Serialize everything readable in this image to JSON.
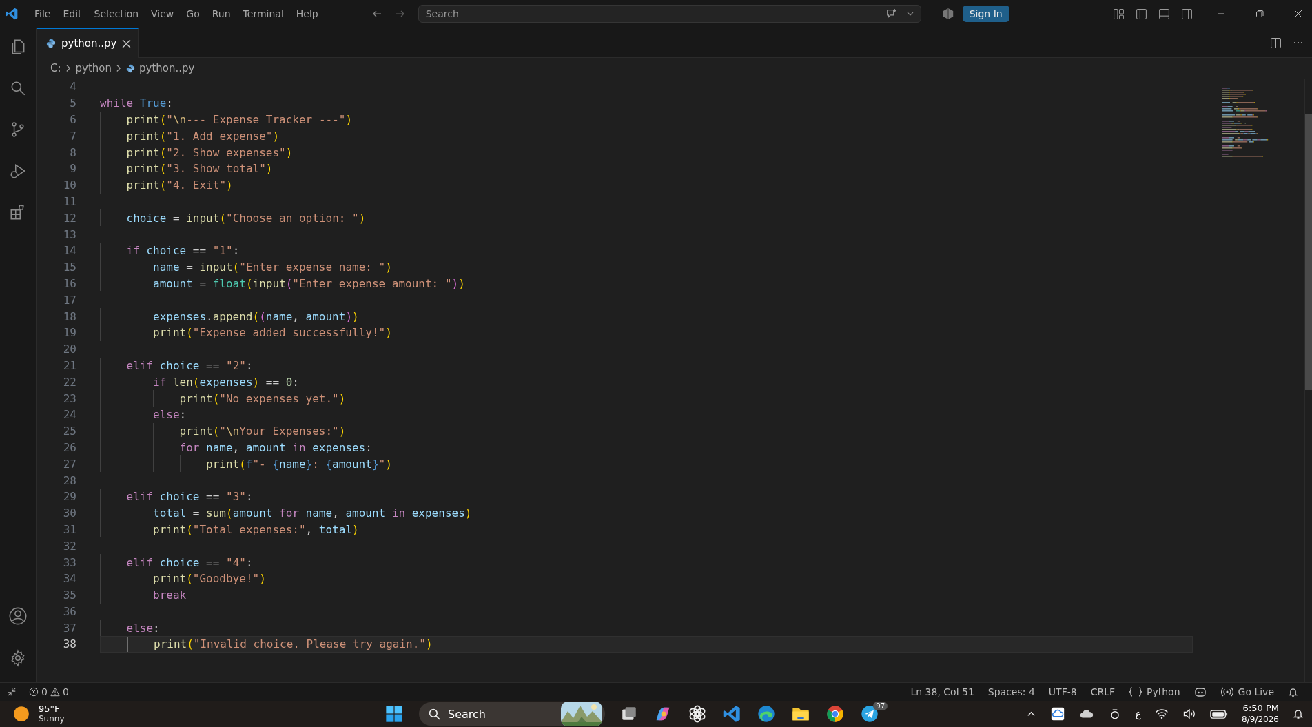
{
  "menu_bar": {
    "items": [
      "File",
      "Edit",
      "Selection",
      "View",
      "Go",
      "Run",
      "Terminal",
      "Help"
    ]
  },
  "command_center": {
    "placeholder": "Search"
  },
  "account_button": "Sign In",
  "tabs": [
    {
      "label": "python..py",
      "selected": true
    }
  ],
  "breadcrumb": [
    "C:",
    "python",
    "python..py"
  ],
  "editor": {
    "lines": [
      {
        "number": "4",
        "selected": false
      },
      {
        "number": "5",
        "selected": false,
        "tokens": [
          {
            "kind": "kw",
            "text": "while "
          },
          {
            "kind": "const",
            "text": "True"
          },
          {
            "kind": "op",
            "text": ":"
          }
        ]
      },
      {
        "number": "6",
        "selected": false,
        "tokens": [
          {
            "kind": "fn",
            "text": "    print"
          },
          {
            "kind": "b1",
            "text": "("
          },
          {
            "kind": "str",
            "text": "\""
          },
          {
            "kind": "esc",
            "text": "\\n"
          },
          {
            "kind": "str",
            "text": "--- Expense Tracker ---\""
          },
          {
            "kind": "b1",
            "text": ")"
          }
        ]
      },
      {
        "number": "7",
        "selected": false,
        "tokens": [
          {
            "kind": "fn",
            "text": "    print"
          },
          {
            "kind": "b1",
            "text": "("
          },
          {
            "kind": "str",
            "text": "\"1. Add expense\""
          },
          {
            "kind": "b1",
            "text": ")"
          }
        ]
      },
      {
        "number": "8",
        "selected": false,
        "tokens": [
          {
            "kind": "fn",
            "text": "    print"
          },
          {
            "kind": "b1",
            "text": "("
          },
          {
            "kind": "str",
            "text": "\"2. Show expenses\""
          },
          {
            "kind": "b1",
            "text": ")"
          }
        ]
      },
      {
        "number": "9",
        "selected": false,
        "tokens": [
          {
            "kind": "fn",
            "text": "    print"
          },
          {
            "kind": "b1",
            "text": "("
          },
          {
            "kind": "str",
            "text": "\"3. Show total\""
          },
          {
            "kind": "b1",
            "text": ")"
          }
        ]
      },
      {
        "number": "10",
        "selected": false,
        "tokens": [
          {
            "kind": "fn",
            "text": "    print"
          },
          {
            "kind": "b1",
            "text": "("
          },
          {
            "kind": "str",
            "text": "\"4. Exit\""
          },
          {
            "kind": "b1",
            "text": ")"
          }
        ]
      },
      {
        "number": "11",
        "selected": false
      },
      {
        "number": "12",
        "selected": false,
        "tokens": [
          {
            "kind": "var",
            "text": "    choice"
          },
          {
            "kind": "op",
            "text": " = "
          },
          {
            "kind": "fn",
            "text": "input"
          },
          {
            "kind": "b1",
            "text": "("
          },
          {
            "kind": "str",
            "text": "\"Choose an option: \""
          },
          {
            "kind": "b1",
            "text": ")"
          }
        ]
      },
      {
        "number": "13",
        "selected": false
      },
      {
        "number": "14",
        "selected": false,
        "tokens": [
          {
            "kind": "kw",
            "text": "    if "
          },
          {
            "kind": "var",
            "text": "choice"
          },
          {
            "kind": "op",
            "text": " == "
          },
          {
            "kind": "str",
            "text": "\"1\""
          },
          {
            "kind": "op",
            "text": ":"
          }
        ]
      },
      {
        "number": "15",
        "selected": false,
        "tokens": [
          {
            "kind": "var",
            "text": "        name"
          },
          {
            "kind": "op",
            "text": " = "
          },
          {
            "kind": "fn",
            "text": "input"
          },
          {
            "kind": "b1",
            "text": "("
          },
          {
            "kind": "str",
            "text": "\"Enter expense name: \""
          },
          {
            "kind": "b1",
            "text": ")"
          }
        ]
      },
      {
        "number": "16",
        "selected": false,
        "tokens": [
          {
            "kind": "var",
            "text": "        amount"
          },
          {
            "kind": "op",
            "text": " = "
          },
          {
            "kind": "type",
            "text": "float"
          },
          {
            "kind": "b1",
            "text": "("
          },
          {
            "kind": "fn",
            "text": "input"
          },
          {
            "kind": "b2",
            "text": "("
          },
          {
            "kind": "str",
            "text": "\"Enter expense amount: \""
          },
          {
            "kind": "b2",
            "text": ")"
          },
          {
            "kind": "b1",
            "text": ")"
          }
        ]
      },
      {
        "number": "17",
        "selected": false
      },
      {
        "number": "18",
        "selected": false,
        "tokens": [
          {
            "kind": "var",
            "text": "        expenses"
          },
          {
            "kind": "op",
            "text": "."
          },
          {
            "kind": "fn",
            "text": "append"
          },
          {
            "kind": "b1",
            "text": "("
          },
          {
            "kind": "b2",
            "text": "("
          },
          {
            "kind": "var",
            "text": "name"
          },
          {
            "kind": "op",
            "text": ", "
          },
          {
            "kind": "var",
            "text": "amount"
          },
          {
            "kind": "b2",
            "text": ")"
          },
          {
            "kind": "b1",
            "text": ")"
          }
        ]
      },
      {
        "number": "19",
        "selected": false,
        "tokens": [
          {
            "kind": "fn",
            "text": "        print"
          },
          {
            "kind": "b1",
            "text": "("
          },
          {
            "kind": "str",
            "text": "\"Expense added successfully!\""
          },
          {
            "kind": "b1",
            "text": ")"
          }
        ]
      },
      {
        "number": "20",
        "selected": false
      },
      {
        "number": "21",
        "selected": false,
        "tokens": [
          {
            "kind": "kw",
            "text": "    elif "
          },
          {
            "kind": "var",
            "text": "choice"
          },
          {
            "kind": "op",
            "text": " == "
          },
          {
            "kind": "str",
            "text": "\"2\""
          },
          {
            "kind": "op",
            "text": ":"
          }
        ]
      },
      {
        "number": "22",
        "selected": false,
        "tokens": [
          {
            "kind": "kw",
            "text": "        if "
          },
          {
            "kind": "fn",
            "text": "len"
          },
          {
            "kind": "b1",
            "text": "("
          },
          {
            "kind": "var",
            "text": "expenses"
          },
          {
            "kind": "b1",
            "text": ")"
          },
          {
            "kind": "op",
            "text": " == "
          },
          {
            "kind": "num",
            "text": "0"
          },
          {
            "kind": "op",
            "text": ":"
          }
        ]
      },
      {
        "number": "23",
        "selected": false,
        "tokens": [
          {
            "kind": "fn",
            "text": "            print"
          },
          {
            "kind": "b1",
            "text": "("
          },
          {
            "kind": "str",
            "text": "\"No expenses yet.\""
          },
          {
            "kind": "b1",
            "text": ")"
          }
        ]
      },
      {
        "number": "24",
        "selected": false,
        "tokens": [
          {
            "kind": "kw",
            "text": "        else"
          },
          {
            "kind": "op",
            "text": ":"
          }
        ]
      },
      {
        "number": "25",
        "selected": false,
        "tokens": [
          {
            "kind": "fn",
            "text": "            print"
          },
          {
            "kind": "b1",
            "text": "("
          },
          {
            "kind": "str",
            "text": "\""
          },
          {
            "kind": "esc",
            "text": "\\n"
          },
          {
            "kind": "str",
            "text": "Your Expenses:\""
          },
          {
            "kind": "b1",
            "text": ")"
          }
        ]
      },
      {
        "number": "26",
        "selected": false,
        "tokens": [
          {
            "kind": "kw",
            "text": "            for "
          },
          {
            "kind": "var",
            "text": "name"
          },
          {
            "kind": "op",
            "text": ", "
          },
          {
            "kind": "var",
            "text": "amount"
          },
          {
            "kind": "kw",
            "text": " in "
          },
          {
            "kind": "var",
            "text": "expenses"
          },
          {
            "kind": "op",
            "text": ":"
          }
        ]
      },
      {
        "number": "27",
        "selected": false,
        "tokens": [
          {
            "kind": "fn",
            "text": "                print"
          },
          {
            "kind": "b1",
            "text": "("
          },
          {
            "kind": "storage",
            "text": "f"
          },
          {
            "kind": "str",
            "text": "\"- "
          },
          {
            "kind": "storage",
            "text": "{"
          },
          {
            "kind": "var",
            "text": "name"
          },
          {
            "kind": "storage",
            "text": "}"
          },
          {
            "kind": "str",
            "text": ": "
          },
          {
            "kind": "storage",
            "text": "{"
          },
          {
            "kind": "var",
            "text": "amount"
          },
          {
            "kind": "storage",
            "text": "}"
          },
          {
            "kind": "str",
            "text": "\""
          },
          {
            "kind": "b1",
            "text": ")"
          }
        ]
      },
      {
        "number": "28",
        "selected": false
      },
      {
        "number": "29",
        "selected": false,
        "tokens": [
          {
            "kind": "kw",
            "text": "    elif "
          },
          {
            "kind": "var",
            "text": "choice"
          },
          {
            "kind": "op",
            "text": " == "
          },
          {
            "kind": "str",
            "text": "\"3\""
          },
          {
            "kind": "op",
            "text": ":"
          }
        ]
      },
      {
        "number": "30",
        "selected": false,
        "tokens": [
          {
            "kind": "var",
            "text": "        total"
          },
          {
            "kind": "op",
            "text": " = "
          },
          {
            "kind": "fn",
            "text": "sum"
          },
          {
            "kind": "b1",
            "text": "("
          },
          {
            "kind": "var",
            "text": "amount"
          },
          {
            "kind": "kw",
            "text": " for "
          },
          {
            "kind": "var",
            "text": "name"
          },
          {
            "kind": "op",
            "text": ", "
          },
          {
            "kind": "var",
            "text": "amount"
          },
          {
            "kind": "kw",
            "text": " in "
          },
          {
            "kind": "var",
            "text": "expenses"
          },
          {
            "kind": "b1",
            "text": ")"
          }
        ]
      },
      {
        "number": "31",
        "selected": false,
        "tokens": [
          {
            "kind": "fn",
            "text": "        print"
          },
          {
            "kind": "b1",
            "text": "("
          },
          {
            "kind": "str",
            "text": "\"Total expenses:\""
          },
          {
            "kind": "op",
            "text": ", "
          },
          {
            "kind": "var",
            "text": "total"
          },
          {
            "kind": "b1",
            "text": ")"
          }
        ]
      },
      {
        "number": "32",
        "selected": false
      },
      {
        "number": "33",
        "selected": false,
        "tokens": [
          {
            "kind": "kw",
            "text": "    elif "
          },
          {
            "kind": "var",
            "text": "choice"
          },
          {
            "kind": "op",
            "text": " == "
          },
          {
            "kind": "str",
            "text": "\"4\""
          },
          {
            "kind": "op",
            "text": ":"
          }
        ]
      },
      {
        "number": "34",
        "selected": false,
        "tokens": [
          {
            "kind": "fn",
            "text": "        print"
          },
          {
            "kind": "b1",
            "text": "("
          },
          {
            "kind": "str",
            "text": "\"Goodbye!\""
          },
          {
            "kind": "b1",
            "text": ")"
          }
        ]
      },
      {
        "number": "35",
        "selected": false,
        "tokens": [
          {
            "kind": "kw",
            "text": "        break"
          }
        ]
      },
      {
        "number": "36",
        "selected": false
      },
      {
        "number": "37",
        "selected": false,
        "tokens": [
          {
            "kind": "kw",
            "text": "    else"
          },
          {
            "kind": "op",
            "text": ":"
          }
        ]
      },
      {
        "number": "38",
        "selected": true,
        "tokens": [
          {
            "kind": "fn",
            "text": "        print"
          },
          {
            "kind": "b1",
            "text": "("
          },
          {
            "kind": "str",
            "text": "\"Invalid choice. Please try again.\""
          },
          {
            "kind": "b1",
            "text": ")"
          }
        ]
      }
    ]
  },
  "status_bar": {
    "errors": "0",
    "warnings": "0",
    "position": "Ln 38, Col 51",
    "indentation": "Spaces: 4",
    "encoding": "UTF-8",
    "line_ending": "CRLF",
    "language": "Python",
    "live_server": "Go Live"
  },
  "taskbar": {
    "weather": {
      "temperature": "95°F",
      "condition": "Sunny"
    },
    "search": {
      "placeholder": "Search"
    },
    "telegram_badge": "97",
    "keyboard_language": "ع",
    "time": "6:50 PM",
    "date": "8/9/2026"
  }
}
